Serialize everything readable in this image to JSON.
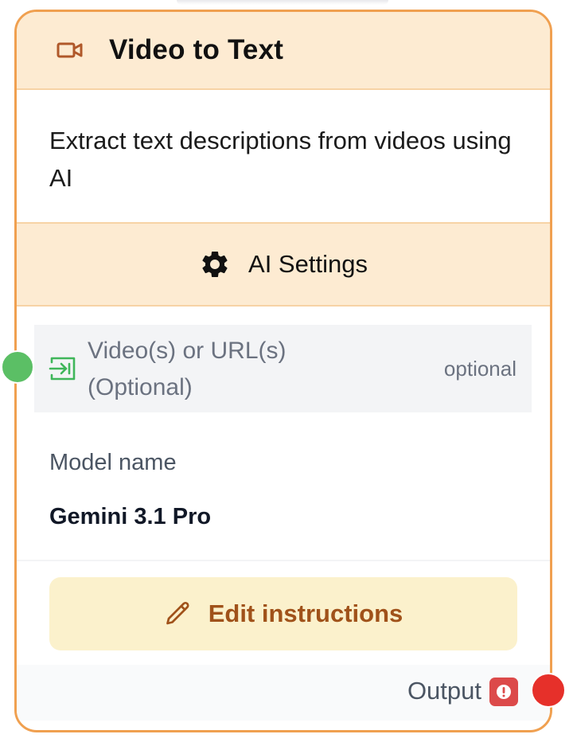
{
  "node": {
    "title": "Video to Text",
    "title_icon": "video-camera-icon",
    "description": "Extract text descriptions from videos using AI",
    "settings_label": "AI Settings",
    "settings_icon": "gear-icon",
    "input": {
      "label": "Video(s) or URL(s) (Optional)",
      "badge": "optional",
      "icon": "input-arrow-icon"
    },
    "model": {
      "label": "Model name",
      "value": "Gemini 3.1 Pro"
    },
    "edit_button_label": "Edit instructions",
    "edit_icon": "pencil-icon",
    "output_label": "Output",
    "output_icon": "warning-icon"
  },
  "colors": {
    "border": "#f0a050",
    "header_bg": "#fdebd2",
    "accent_brown": "#a0521a",
    "input_handle": "#5bbf65",
    "output_handle": "#e6302a",
    "input_icon": "#3fb65a"
  }
}
